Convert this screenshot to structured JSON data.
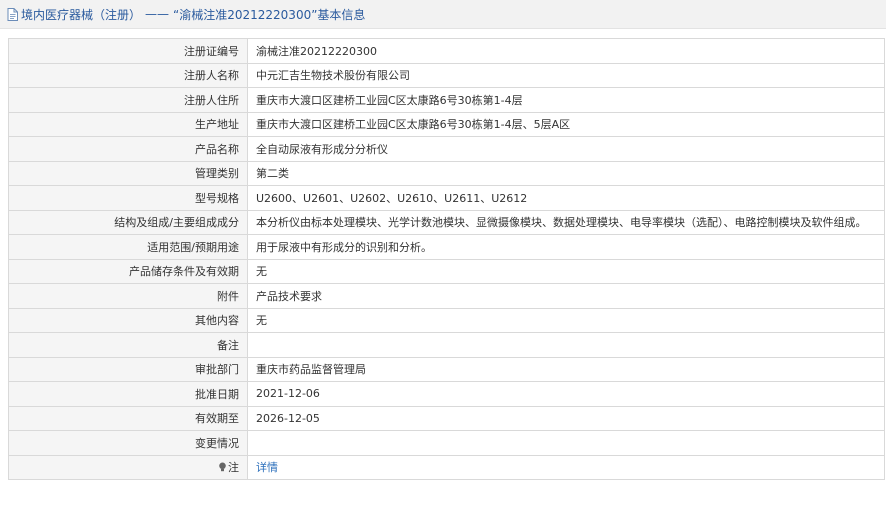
{
  "header": {
    "category": "境内医疗器械（注册）",
    "separator": "——",
    "title": "“渝械注准20212220300”基本信息"
  },
  "rows": [
    {
      "label": "注册证编号",
      "value": "渝械注准20212220300"
    },
    {
      "label": "注册人名称",
      "value": "中元汇吉生物技术股份有限公司"
    },
    {
      "label": "注册人住所",
      "value": "重庆市大渡口区建桥工业园C区太康路6号30栋第1-4层"
    },
    {
      "label": "生产地址",
      "value": "重庆市大渡口区建桥工业园C区太康路6号30栋第1-4层、5层A区"
    },
    {
      "label": "产品名称",
      "value": "全自动尿液有形成分分析仪"
    },
    {
      "label": "管理类别",
      "value": "第二类"
    },
    {
      "label": "型号规格",
      "value": "U2600、U2601、U2602、U2610、U2611、U2612"
    },
    {
      "label": "结构及组成/主要组成成分",
      "value": "本分析仪由标本处理模块、光学计数池模块、显微摄像模块、数据处理模块、电导率模块（选配）、电路控制模块及软件组成。"
    },
    {
      "label": "适用范围/预期用途",
      "value": "用于尿液中有形成分的识别和分析。"
    },
    {
      "label": "产品储存条件及有效期",
      "value": "无"
    },
    {
      "label": "附件",
      "value": "产品技术要求"
    },
    {
      "label": "其他内容",
      "value": "无"
    },
    {
      "label": "备注",
      "value": ""
    },
    {
      "label": "审批部门",
      "value": "重庆市药品监督管理局"
    },
    {
      "label": "批准日期",
      "value": "2021-12-06"
    },
    {
      "label": "有效期至",
      "value": "2026-12-05"
    },
    {
      "label": "变更情况",
      "value": ""
    }
  ],
  "note_row": {
    "icon": "lightbulb-icon",
    "label": "注",
    "link_text": "详情"
  },
  "colors": {
    "header_text": "#2a5a9e",
    "link": "#2a6ebb",
    "label_bg": "#f5f5f5",
    "border": "#d9d9d9"
  }
}
